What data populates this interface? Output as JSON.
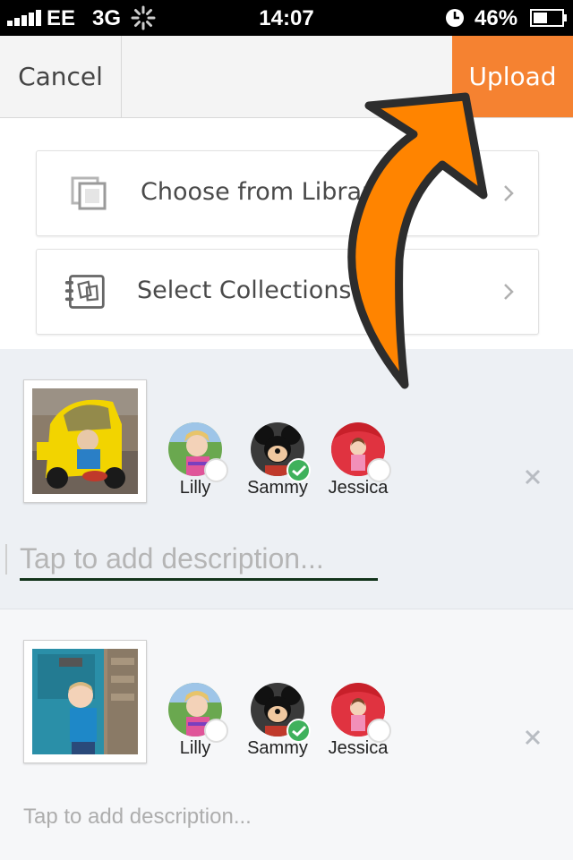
{
  "status_bar": {
    "carrier": "EE",
    "network": "3G",
    "time": "14:07",
    "battery": "46%"
  },
  "nav": {
    "cancel_label": "Cancel",
    "upload_label": "Upload",
    "accent": "#f58231"
  },
  "options": [
    {
      "label": "Choose from Library",
      "icon": "photo-library-icon"
    },
    {
      "label": "Select Collections",
      "icon": "collections-icon"
    }
  ],
  "photos": [
    {
      "subject": "toddler in yellow toy car",
      "people": [
        {
          "name": "Lilly",
          "selected": false
        },
        {
          "name": "Sammy",
          "selected": true
        },
        {
          "name": "Jessica",
          "selected": false
        }
      ],
      "description_placeholder": "Tap to add description..."
    },
    {
      "subject": "toddler by blue door",
      "people": [
        {
          "name": "Lilly",
          "selected": false
        },
        {
          "name": "Sammy",
          "selected": true
        },
        {
          "name": "Jessica",
          "selected": false
        }
      ],
      "description_placeholder": "Tap to add description..."
    }
  ],
  "overlay": {
    "annotation": "orange-arrow-pointing-to-upload",
    "color": "#ff8400"
  }
}
